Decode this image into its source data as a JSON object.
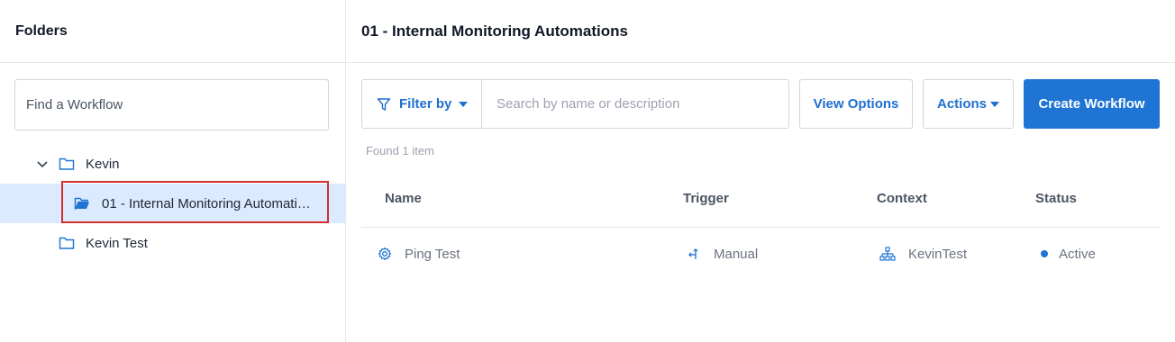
{
  "sidebar": {
    "title": "Folders",
    "search_placeholder": "Find a Workflow",
    "tree": [
      {
        "label": "Kevin",
        "icon": "folder-icon",
        "expanded": true
      },
      {
        "label": "01 - Internal Monitoring Automati…",
        "icon": "folder-open-icon",
        "selected": true
      },
      {
        "label": "Kevin Test",
        "icon": "folder-icon"
      }
    ]
  },
  "main": {
    "title": "01 - Internal Monitoring Automations",
    "filter_label": "Filter by",
    "search_placeholder": "Search by name or description",
    "view_options_label": "View Options",
    "actions_label": "Actions",
    "create_label": "Create Workflow",
    "found_text": "Found 1 item",
    "columns": [
      "Name",
      "Trigger",
      "Context",
      "Status"
    ],
    "rows": [
      {
        "name": "Ping Test",
        "trigger": "Manual",
        "context": "KevinTest",
        "status": "Active"
      }
    ]
  },
  "colors": {
    "accent": "#1f74d4",
    "selected_bg": "#dbeafe",
    "selection_outline": "#d32f2f"
  }
}
